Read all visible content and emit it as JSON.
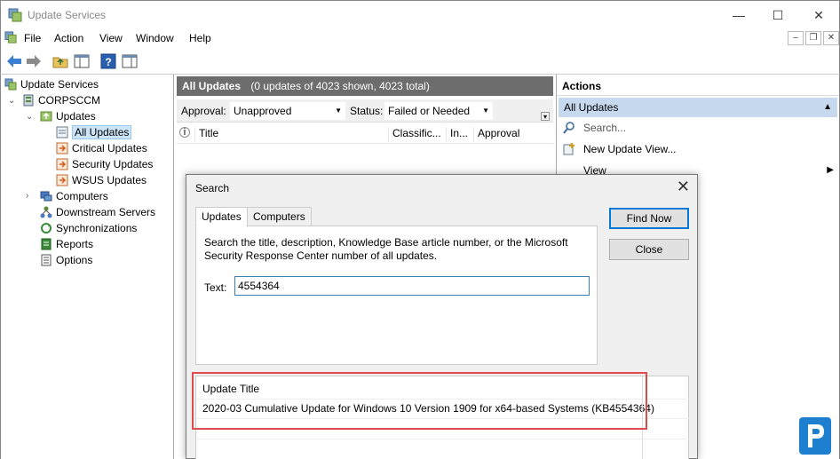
{
  "window": {
    "title": "Update Services",
    "minimize_glyph": "—",
    "maximize_glyph": "☐",
    "close_glyph": "✕"
  },
  "menu": {
    "items": [
      "File",
      "Action",
      "View",
      "Window",
      "Help"
    ],
    "mdi_minimize": "–",
    "mdi_restore": "❐",
    "mdi_close": "✕"
  },
  "tree": {
    "root": "Update Services",
    "server": "CORPSCCM",
    "updates": "Updates",
    "all_updates": "All Updates",
    "critical_updates": "Critical Updates",
    "security_updates": "Security Updates",
    "wsus_updates": "WSUS Updates",
    "computers": "Computers",
    "downstream_servers": "Downstream Servers",
    "synchronizations": "Synchronizations",
    "reports": "Reports",
    "options": "Options"
  },
  "center": {
    "header_title": "All Updates",
    "header_count": "(0 updates of 4023 shown, 4023 total)",
    "approval_label": "Approval:",
    "approval_value": "Unapproved",
    "status_label": "Status:",
    "status_value": "Failed or Needed",
    "columns": [
      "Title",
      "Classific...",
      "In...",
      "Approval"
    ]
  },
  "actions": {
    "header": "Actions",
    "section": "All Updates",
    "items": [
      "Search...",
      "New Update View...",
      "View"
    ]
  },
  "dialog": {
    "title": "Search",
    "close_glyph": "✕",
    "tabs": [
      "Updates",
      "Computers"
    ],
    "description": "Search the title, description, Knowledge Base article number, or the Microsoft Security Response Center number of all updates.",
    "text_label": "Text:",
    "text_value": "4554364",
    "find_now": "Find Now",
    "close": "Close",
    "results_header": "Update Title",
    "results": [
      "2020-03 Cumulative Update for Windows 10 Version 1909 for x64-based Systems (KB4554364)"
    ]
  },
  "colors": {
    "header_bg": "#6d6d6d",
    "selection": "#cce4f7",
    "actions_section": "#c6d9ee",
    "highlight": "#e04b52",
    "accent": "#0078d7"
  }
}
